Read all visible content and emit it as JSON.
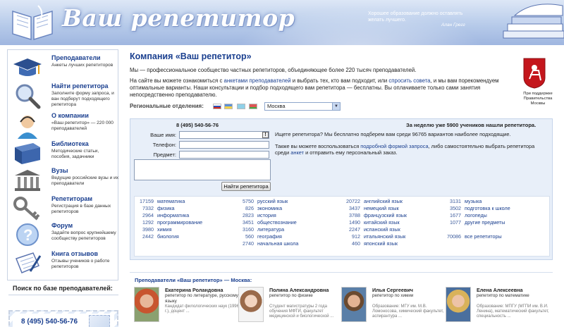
{
  "header": {
    "logo_text": "Ваш репетитор",
    "slogan": "Хорошее образование должно оставлять желать лучшего.",
    "slogan_author": "Алан Грегг"
  },
  "sidebar": {
    "items": [
      {
        "title": "Преподаватели",
        "desc": "Анкеты лучших репетиторов"
      },
      {
        "title": "Найти репетитора",
        "desc": "Заполните форму запроса, и ван подберут подходящего репетитора"
      },
      {
        "title": "О компании",
        "desc": "«Ваш репетитор» — 220 000 преподавателей"
      },
      {
        "title": "Библиотека",
        "desc": "Методические статьи, пособия, задачники"
      },
      {
        "title": "Вузы",
        "desc": "Ведущие российские вузы и их преподаватели"
      },
      {
        "title": "Репетиторам",
        "desc": "Регистрация в базе данных репетиторов"
      },
      {
        "title": "Форум",
        "desc": "Задайте вопрос крупнейшему сообществу репетиторов"
      },
      {
        "title": "Книга отзывов",
        "desc": "Отзывы учеников о работе репетиторов"
      }
    ],
    "search_title": "Поиск по базе преподавателей:",
    "phone": "8 (495) 540-56-76"
  },
  "main": {
    "title": "Компания «Ваш репетитор»",
    "intro": "Мы — профессиональное сообщество частных репетиторов, объединяющее более 220 тысяч преподавателей.",
    "p2_a": "На сайте вы можете ознакомиться с ",
    "p2_link1": "анкетами преподавателей",
    "p2_b": " и выбрать тех, кто вам подходит, или ",
    "p2_link2": "спросить совета",
    "p2_c": ", и мы вам порекомендуем оптимальные варианты. Наши консультации и подбор подходящего вам репетитора — бесплатны. Вы оплачиваете только сами занятия непосредственно преподавателю.",
    "coat_caption": "При поддержке Правительства Москвы",
    "regional_label": "Региональные отделения:",
    "city": "Москва"
  },
  "panel": {
    "phone": "8 (495) 540-56-76",
    "week": "За неделю уже 5900 учеников нашли репетитора.",
    "label_name": "Ваше имя:",
    "label_phone": "Телефон:",
    "label_subject": "Предмет:",
    "button": "Найти репетитора",
    "question": "Ищете репетитора? Мы бесплатно подберем вам среди 96765 вариантов наиболее подходящие.",
    "also_a": "Также вы можете воспользоваться ",
    "also_link1": "подробной формой запроса",
    "also_b": ", либо самостоятельно выбрать репетитора среди ",
    "also_link2": "анкет",
    "also_c": " и отправить ему персональный заказ."
  },
  "subjects": [
    [
      {
        "n": "17159",
        "t": "математика"
      },
      {
        "n": "7332",
        "t": "физика"
      },
      {
        "n": "2964",
        "t": "информатика"
      },
      {
        "n": "1292",
        "t": "программирование"
      },
      {
        "n": "3980",
        "t": "химия"
      },
      {
        "n": "2442",
        "t": "биология"
      }
    ],
    [
      {
        "n": "5750",
        "t": "русский язык"
      },
      {
        "n": "826",
        "t": "экономика"
      },
      {
        "n": "2823",
        "t": "история"
      },
      {
        "n": "3451",
        "t": "обществознание"
      },
      {
        "n": "3160",
        "t": "литература"
      },
      {
        "n": "560",
        "t": "география"
      },
      {
        "n": "2740",
        "t": "начальная школа"
      }
    ],
    [
      {
        "n": "20722",
        "t": "английский язык"
      },
      {
        "n": "3437",
        "t": "немецкий язык"
      },
      {
        "n": "3788",
        "t": "французский язык"
      },
      {
        "n": "1490",
        "t": "китайский язык"
      },
      {
        "n": "2247",
        "t": "испанский язык"
      },
      {
        "n": "912",
        "t": "итальянский язык"
      },
      {
        "n": "460",
        "t": "японский язык"
      }
    ],
    [
      {
        "n": "3131",
        "t": "музыка"
      },
      {
        "n": "3502",
        "t": "подготовка к школе"
      },
      {
        "n": "1677",
        "t": "логопеды"
      },
      {
        "n": "1077",
        "t": "другие предметы"
      },
      {
        "n": "",
        "t": ""
      },
      {
        "n": "70086",
        "t": "все репетиторы"
      }
    ]
  ],
  "teachers": {
    "title": "Преподаватели «Ваш репетитор» — Москва:",
    "cards": [
      {
        "name": "Екатерина Роландовна",
        "role": "репетитор по литературе, русскому языку",
        "info": "Кандидат филологических наук (1996 г.), доцент ..."
      },
      {
        "name": "Полина Александровна",
        "role": "репетитор по физике",
        "info": "Студент магистратуры 2 года обучения МФТИ, факультет медицинской и биологической ..."
      },
      {
        "name": "Илья Сергеевич",
        "role": "репетитор по химии",
        "info": "Образование: МГУ им. М.В. Ломоносова, химический факультет, аспирантура ..."
      },
      {
        "name": "Елена Алексеевна",
        "role": "репетитор по математике",
        "info": "Образование: МПГУ (МГПИ им. В.И. Ленина), математический факультет, специальность ..."
      }
    ]
  }
}
